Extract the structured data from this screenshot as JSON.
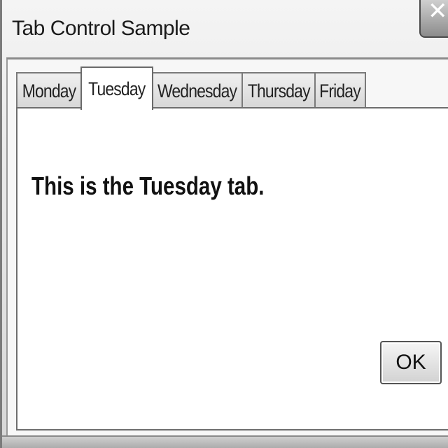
{
  "window": {
    "title": "Tab Control Sample",
    "close_glyph": "✕"
  },
  "tabs": [
    {
      "label": "Monday",
      "selected": false
    },
    {
      "label": "Tuesday",
      "selected": true
    },
    {
      "label": "Wednesday",
      "selected": false
    },
    {
      "label": "Thursday",
      "selected": false
    },
    {
      "label": "Friday",
      "selected": false
    }
  ],
  "tab_page": {
    "text": "This is the Tuesday tab."
  },
  "buttons": {
    "ok_label": "OK"
  },
  "icons": {
    "close": "close-icon"
  }
}
